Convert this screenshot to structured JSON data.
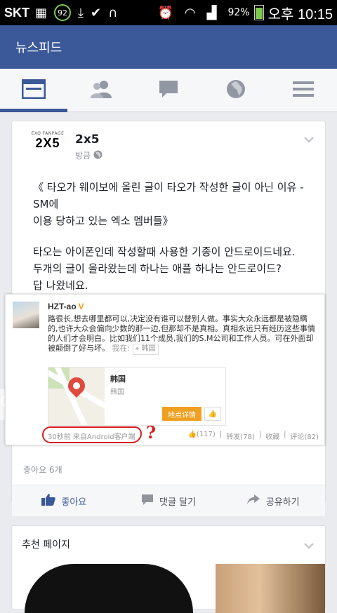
{
  "status_bar": {
    "carrier": "SKT",
    "notification_count": "92",
    "battery_percent": "92%",
    "time": "오후 10:15"
  },
  "header": {
    "title": "뉴스피드"
  },
  "post": {
    "page_name": "2x5",
    "logo_small": "EXO FANPAGE",
    "logo_big": "2X5",
    "timestamp": "방금",
    "body_line1": "《 타오가 웨이보에 올린 글이 타오가 작성한 글이 아닌 이유 - SM에",
    "body_line2": "이용 당하고 있는 엑소 멤버들》",
    "body_line3": "타오는 아이폰인데 작성할때 사용한 기종이 안드로이드네요.",
    "body_line4": "두개의 글이 올라왔는데 하나는 애플 하나는 안드로이드?",
    "body_line5": "답 나왔네요.",
    "embed": {
      "username": "HZT-ao",
      "badge": "V",
      "text": "路很长,想去哪里都可以,决定没有谁可以替别人做。事实大众永远都是被隐瞒的,也许大众会偏向少数的那一边,但那却不是真相。真相永远只有经历这些事情的人们才会明白。比如我们11个成员,我们的S.M公司和工作人员。可在外面却被颠倒了好与坏。",
      "location_prefix": "我在:",
      "location": "韩国",
      "place_title": "韩国",
      "place_sub": "韩国",
      "detail_button": "地点详情",
      "footer_time": "30秒前",
      "footer_source": "来自Android客户端",
      "question_mark": "?",
      "likes": "(117)",
      "reposts": "转发(78)",
      "favorites": "收藏",
      "comments": "评论(82)"
    },
    "likes_count": "좋아요 6개",
    "actions": {
      "like": "좋아요",
      "comment": "댓글 달기",
      "share": "공유하기"
    }
  },
  "recommended": {
    "title": "추천 페이지"
  }
}
